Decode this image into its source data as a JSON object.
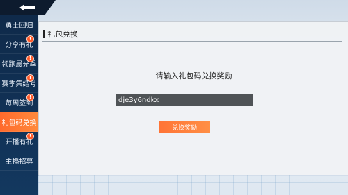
{
  "sidebar": {
    "items": [
      {
        "label": "勇士回归",
        "badge": ""
      },
      {
        "label": "分享有礼",
        "badge": "!"
      },
      {
        "label": "领跑晨光季",
        "badge": "!"
      },
      {
        "label": "赛季集结号",
        "badge": "!"
      },
      {
        "label": "每周签到",
        "badge": "!"
      },
      {
        "label": "礼包码兑换",
        "badge": ""
      },
      {
        "label": "开播有礼",
        "badge": "!"
      },
      {
        "label": "主播招募",
        "badge": ""
      }
    ],
    "active_index": 5
  },
  "panel": {
    "title": "礼包兑换",
    "prompt": "请输入礼包码兑换奖励",
    "code_value": "dje3y6ndkx",
    "redeem_label": "兑换奖励"
  },
  "colors": {
    "accent": "#ff7a38",
    "sidebar_bg": "#13385f",
    "badge": "#ff5a2a"
  }
}
